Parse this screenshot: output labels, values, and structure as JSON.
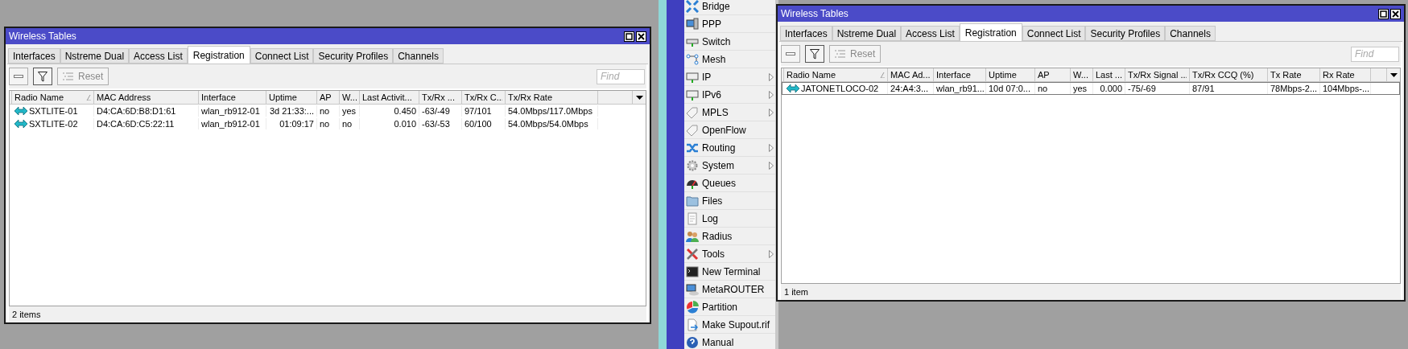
{
  "windows": [
    {
      "title": "Wireless Tables",
      "tabs": [
        {
          "label": "Interfaces",
          "selected": false
        },
        {
          "label": "Nstreme Dual",
          "selected": false
        },
        {
          "label": "Access List",
          "selected": false
        },
        {
          "label": "Registration",
          "selected": true
        },
        {
          "label": "Connect List",
          "selected": false
        },
        {
          "label": "Security Profiles",
          "selected": false
        },
        {
          "label": "Channels",
          "selected": false
        }
      ],
      "toolbar": {
        "reset": {
          "label": "Reset",
          "disabled": true
        },
        "search": {
          "placeholder": "Find"
        }
      },
      "table": {
        "columns": [
          {
            "label": "Radio Name",
            "sorted": true
          },
          {
            "label": "MAC Address",
            "sorted": false
          },
          {
            "label": "Interface",
            "sorted": false
          },
          {
            "label": "Uptime",
            "sorted": false
          },
          {
            "label": "AP",
            "sorted": false
          },
          {
            "label": "W...",
            "sorted": false
          },
          {
            "label": "Last Activit...",
            "sorted": false
          },
          {
            "label": "Tx/Rx ...",
            "sorted": false
          },
          {
            "label": "Tx/Rx C...",
            "sorted": false
          },
          {
            "label": "Tx/Rx Rate",
            "sorted": false
          }
        ],
        "rows": [
          {
            "selected": false,
            "cells": [
              "SXTLITE-01",
              "D4:CA:6D:B8:D1:61",
              "wlan_rb912-01",
              "3d 21:33:...",
              "no",
              "yes",
              "0.450",
              "-63/-49",
              "97/101",
              "54.0Mbps/117.0Mbps"
            ]
          },
          {
            "selected": false,
            "cells": [
              "SXTLITE-02",
              "D4:CA:6D:C5:22:11",
              "wlan_rb912-01",
              "01:09:17",
              "no",
              "no",
              "0.010",
              "-63/-53",
              "60/100",
              "54.0Mbps/54.0Mbps"
            ]
          }
        ]
      },
      "status": "2 items"
    },
    {
      "title": "Wireless Tables",
      "tabs": [
        {
          "label": "Interfaces",
          "selected": false
        },
        {
          "label": "Nstreme Dual",
          "selected": false
        },
        {
          "label": "Access List",
          "selected": false
        },
        {
          "label": "Registration",
          "selected": true
        },
        {
          "label": "Connect List",
          "selected": false
        },
        {
          "label": "Security Profiles",
          "selected": false
        },
        {
          "label": "Channels",
          "selected": false
        }
      ],
      "toolbar": {
        "reset": {
          "label": "Reset",
          "disabled": true
        },
        "search": {
          "placeholder": "Find"
        }
      },
      "table": {
        "columns": [
          {
            "label": "Radio Name",
            "sorted": true
          },
          {
            "label": "MAC Ad...",
            "sorted": false
          },
          {
            "label": "Interface",
            "sorted": false
          },
          {
            "label": "Uptime",
            "sorted": false
          },
          {
            "label": "AP",
            "sorted": false
          },
          {
            "label": "W...",
            "sorted": false
          },
          {
            "label": "Last ...",
            "sorted": false
          },
          {
            "label": "Tx/Rx Signal ...",
            "sorted": false
          },
          {
            "label": "Tx/Rx CCQ (%)",
            "sorted": false
          },
          {
            "label": "Tx Rate",
            "sorted": false
          },
          {
            "label": "Rx Rate",
            "sorted": false
          }
        ],
        "rows": [
          {
            "selected": true,
            "cells": [
              "JATONETLOCO-02",
              "24:A4:3...",
              "wlan_rb91...",
              "10d 07:0...",
              "no",
              "yes",
              "0.000",
              "-75/-69",
              "87/91",
              "78Mbps-2...",
              "104Mbps-..."
            ]
          }
        ]
      },
      "status": "1 item"
    }
  ],
  "menu": [
    {
      "label": "Bridge",
      "submenu": false
    },
    {
      "label": "PPP",
      "submenu": false
    },
    {
      "label": "Switch",
      "submenu": false
    },
    {
      "label": "Mesh",
      "submenu": false
    },
    {
      "label": "IP",
      "submenu": true
    },
    {
      "label": "IPv6",
      "submenu": true
    },
    {
      "label": "MPLS",
      "submenu": true
    },
    {
      "label": "OpenFlow",
      "submenu": false
    },
    {
      "label": "Routing",
      "submenu": true
    },
    {
      "label": "System",
      "submenu": true
    },
    {
      "label": "Queues",
      "submenu": false
    },
    {
      "label": "Files",
      "submenu": false
    },
    {
      "label": "Log",
      "submenu": false
    },
    {
      "label": "Radius",
      "submenu": false
    },
    {
      "label": "Tools",
      "submenu": true
    },
    {
      "label": "New Terminal",
      "submenu": false
    },
    {
      "label": "MetaROUTER",
      "submenu": false
    },
    {
      "label": "Partition",
      "submenu": false
    },
    {
      "label": "Make Supout.rif",
      "submenu": false
    },
    {
      "label": "Manual",
      "submenu": false
    }
  ]
}
